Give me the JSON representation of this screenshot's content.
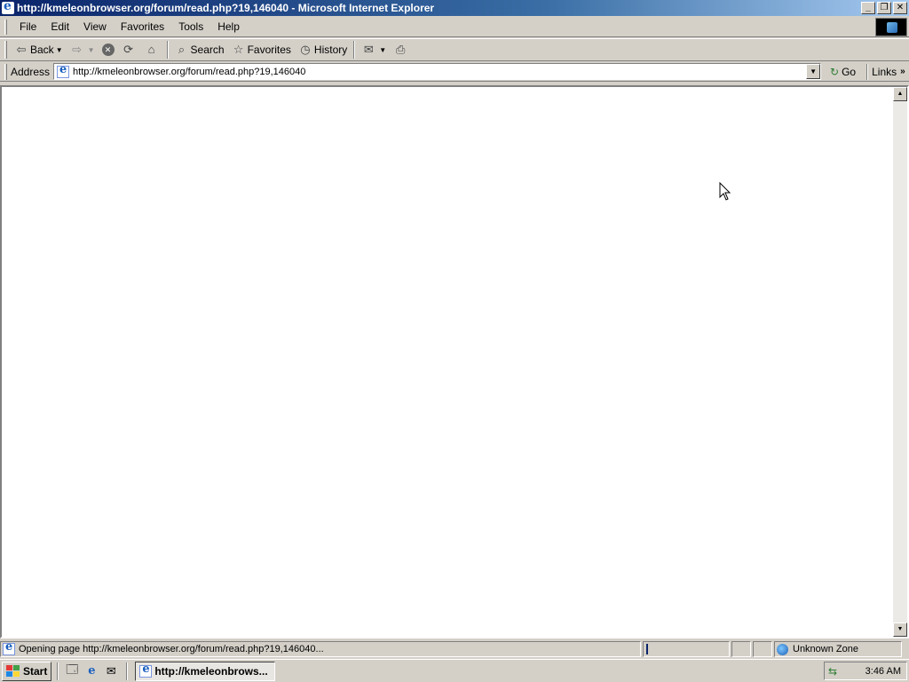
{
  "window": {
    "title": "http://kmeleonbrowser.org/forum/read.php?19,146040 - Microsoft Internet Explorer",
    "minimize": "_",
    "restore": "❐",
    "close": "✕"
  },
  "menubar": {
    "items": [
      "File",
      "Edit",
      "View",
      "Favorites",
      "Tools",
      "Help"
    ]
  },
  "toolbar": {
    "back_label": "Back",
    "search_label": "Search",
    "favorites_label": "Favorites",
    "history_label": "History"
  },
  "addressbar": {
    "label": "Address",
    "url": "http://kmeleonbrowser.org/forum/read.php?19,146040",
    "go_label": "Go",
    "links_label": "Links"
  },
  "statusbar": {
    "message": "Opening page http://kmeleonbrowser.org/forum/read.php?19,146040...",
    "zone": "Unknown Zone"
  },
  "taskbar": {
    "start_label": "Start",
    "task_label": "http://kmeleonbrows...",
    "clock": "3:46 AM"
  }
}
